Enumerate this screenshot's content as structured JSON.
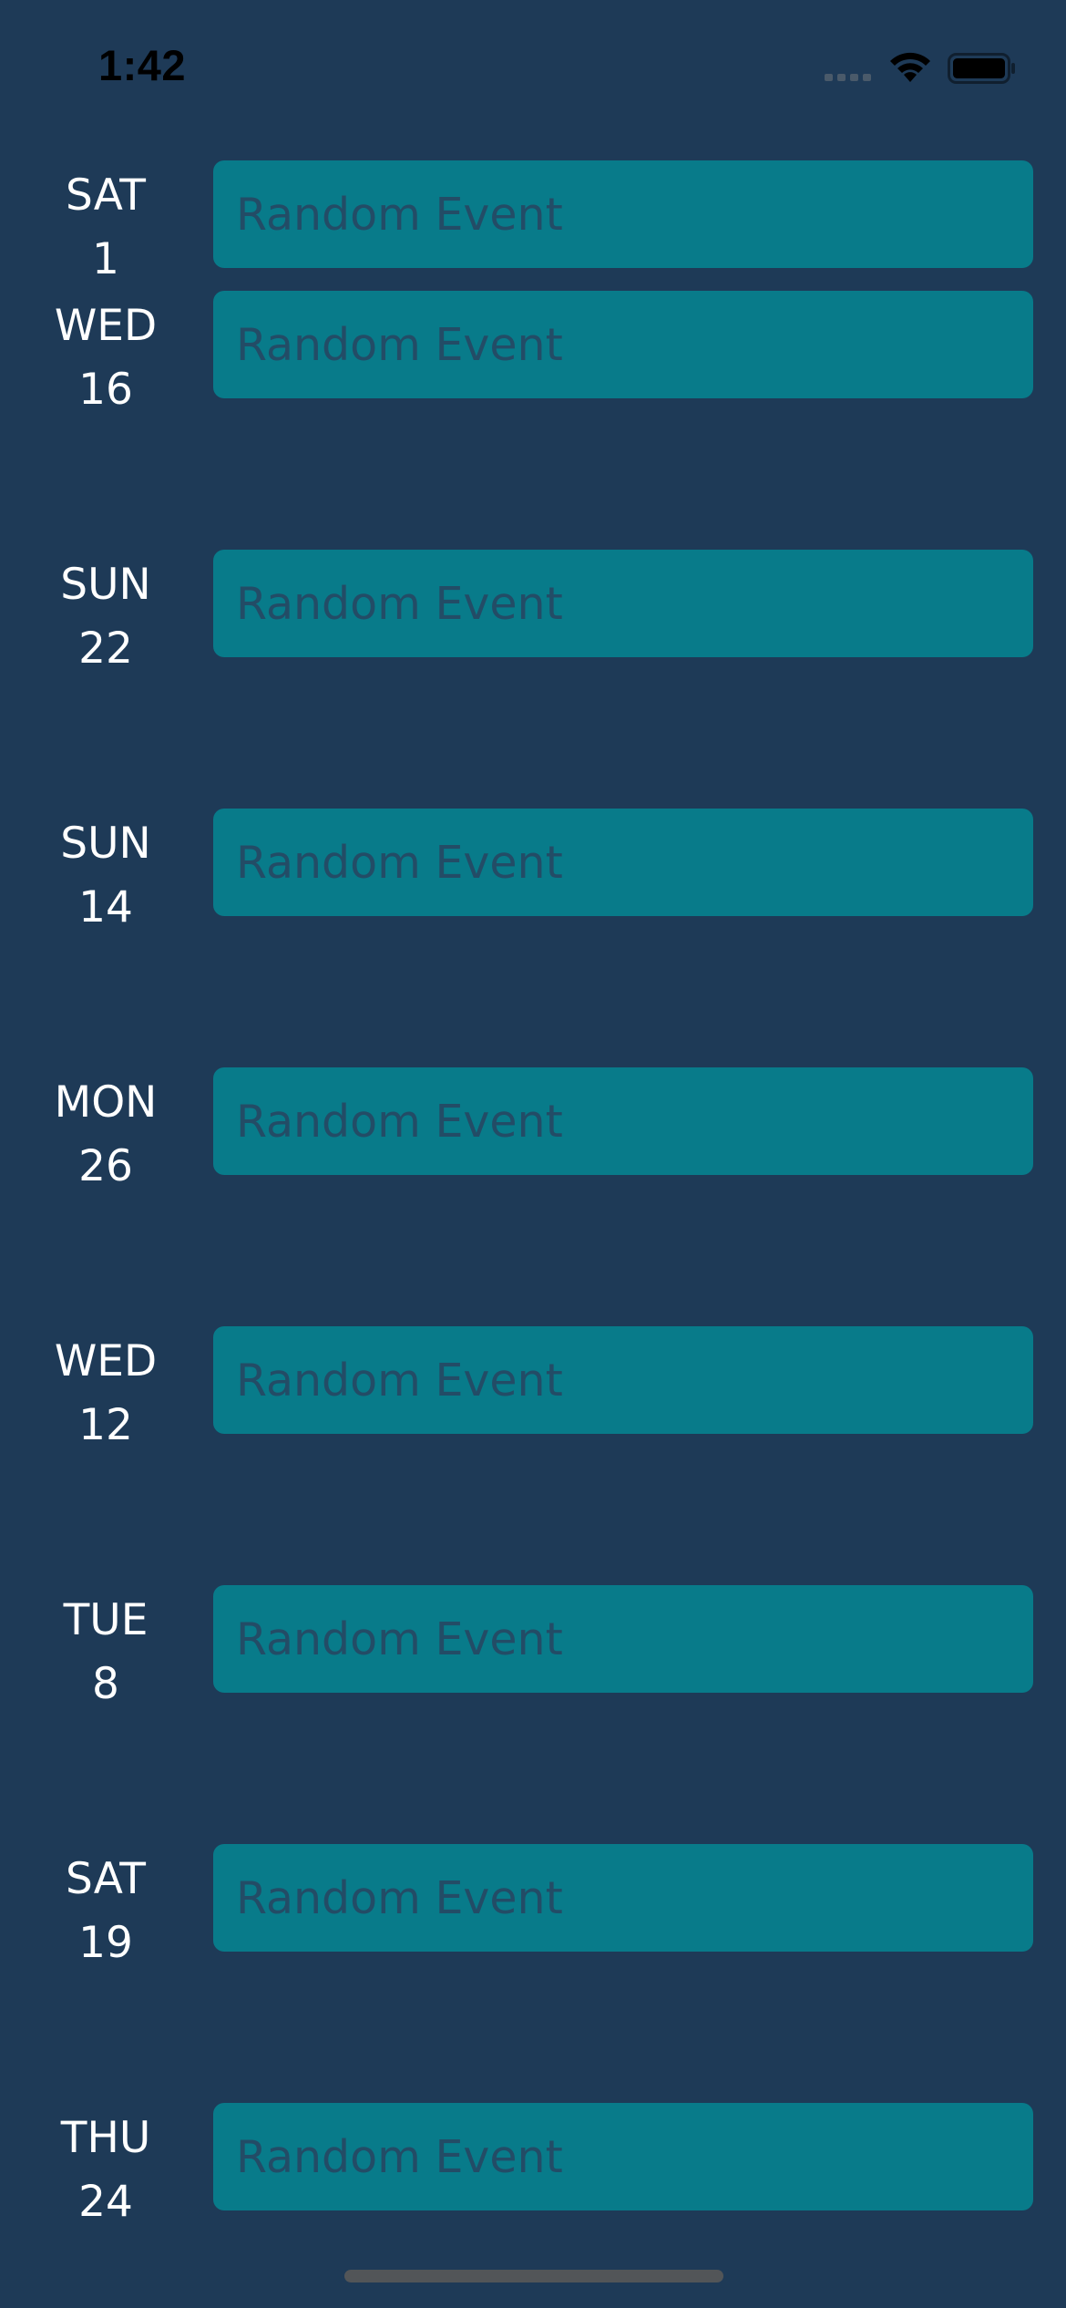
{
  "status_bar": {
    "time": "1:42",
    "icons": [
      "cellular-signal-icon",
      "wifi-icon",
      "battery-icon"
    ]
  },
  "colors": {
    "background": "#1e3a57",
    "event_field": "#087b8a",
    "event_text": "#234c66",
    "day_text": "#ffffff"
  },
  "events": [
    {
      "weekday": "SAT",
      "day": "1",
      "title": "Random Event"
    },
    {
      "weekday": "WED",
      "day": "16",
      "title": "Random Event"
    },
    {
      "weekday": "SUN",
      "day": "22",
      "title": "Random Event"
    },
    {
      "weekday": "SUN",
      "day": "14",
      "title": "Random Event"
    },
    {
      "weekday": "MON",
      "day": "26",
      "title": "Random Event"
    },
    {
      "weekday": "WED",
      "day": "12",
      "title": "Random Event"
    },
    {
      "weekday": "TUE",
      "day": "8",
      "title": "Random Event"
    },
    {
      "weekday": "SAT",
      "day": "19",
      "title": "Random Event"
    },
    {
      "weekday": "THU",
      "day": "24",
      "title": "Random Event"
    }
  ]
}
